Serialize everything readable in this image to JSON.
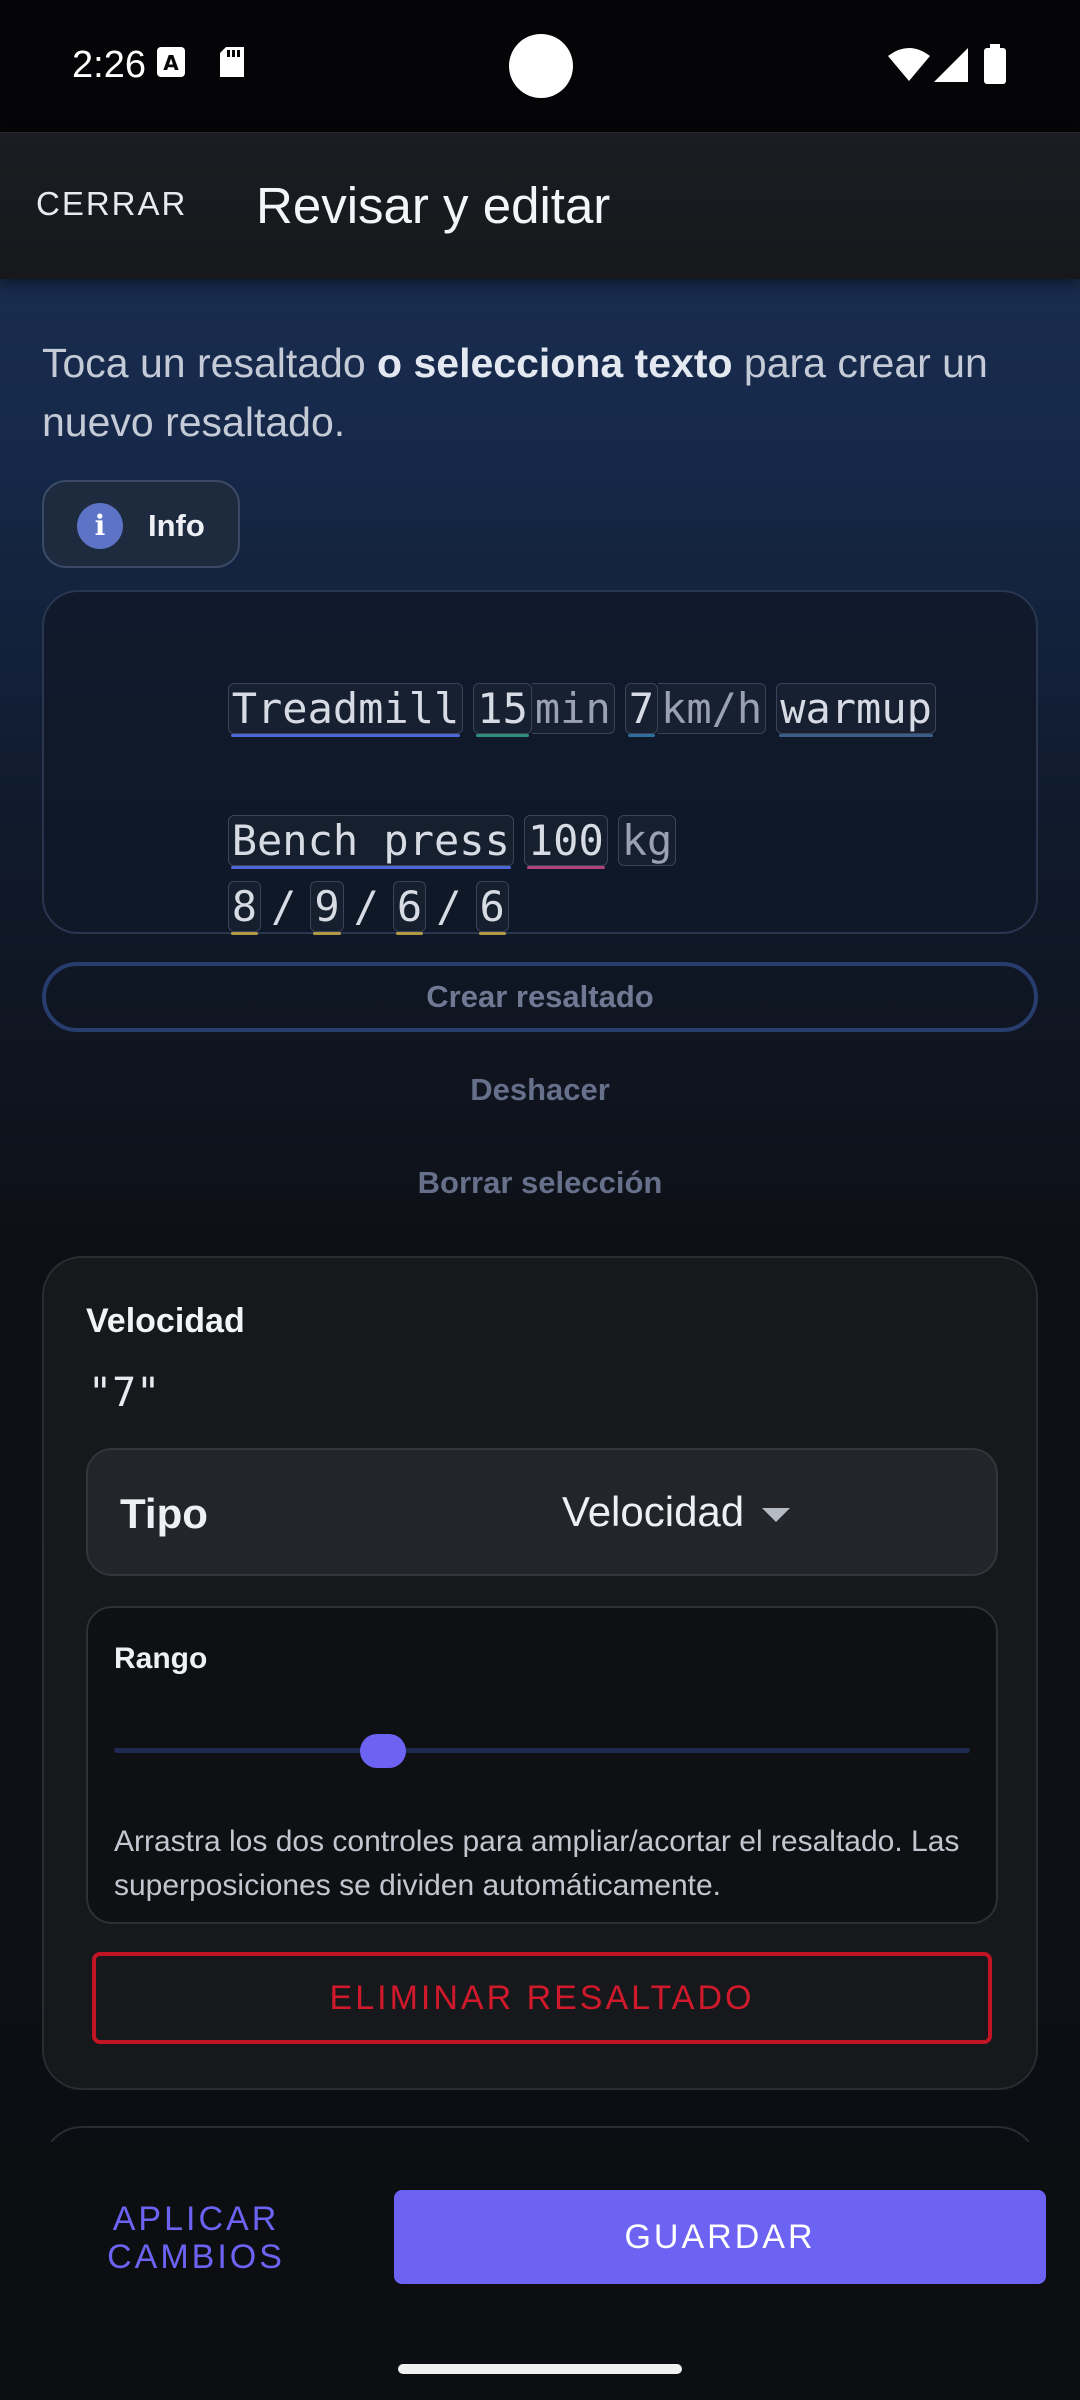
{
  "status_bar": {
    "time": "2:26"
  },
  "app_bar": {
    "close_label": "CERRAR",
    "title": "Revisar y editar"
  },
  "hint": {
    "part1": "Toca un resaltado ",
    "bold": "o selecciona texto",
    "part2": " para crear un nuevo resaltado."
  },
  "info_button": {
    "label": "Info"
  },
  "editor": {
    "line1": [
      {
        "text": "Treadmill",
        "kind": "exercise"
      },
      {
        "text": "15",
        "kind": "duration"
      },
      {
        "text": "min",
        "kind": "unit"
      },
      {
        "text": "7",
        "kind": "speed"
      },
      {
        "text": "km/h",
        "kind": "unit"
      },
      {
        "text": "warmup",
        "kind": "note"
      }
    ],
    "line2": [
      {
        "text": "Bench press",
        "kind": "exercise"
      },
      {
        "text": "100",
        "kind": "weight"
      },
      {
        "text": "kg",
        "kind": "unit"
      }
    ],
    "line3": {
      "reps": [
        "8",
        "9",
        "6",
        "6"
      ],
      "separator": "/"
    }
  },
  "actions": {
    "create_label": "Crear resaltado",
    "undo_label": "Deshacer",
    "clear_label": "Borrar selección"
  },
  "highlight_card": {
    "title": "Velocidad",
    "value": "\"7\"",
    "type_label": "Tipo",
    "type_value": "Velocidad",
    "range_label": "Rango",
    "range_position": 0.27,
    "range_help": "Arrastra los dos controles para ampliar/acortar el resaltado. Las superposiciones se dividen automáticamente.",
    "delete_label": "ELIMINAR RESALTADO"
  },
  "bottom_bar": {
    "apply_label_line1": "APLICAR",
    "apply_label_line2": "CAMBIOS",
    "save_label": "GUARDAR"
  },
  "colors": {
    "accent": "#6c63f2",
    "danger": "#c11425",
    "exercise": "#4d67d6",
    "duration": "#2f8f7a",
    "speed": "#2f6f9e",
    "weight": "#b0437c",
    "reps": "#b29945"
  }
}
